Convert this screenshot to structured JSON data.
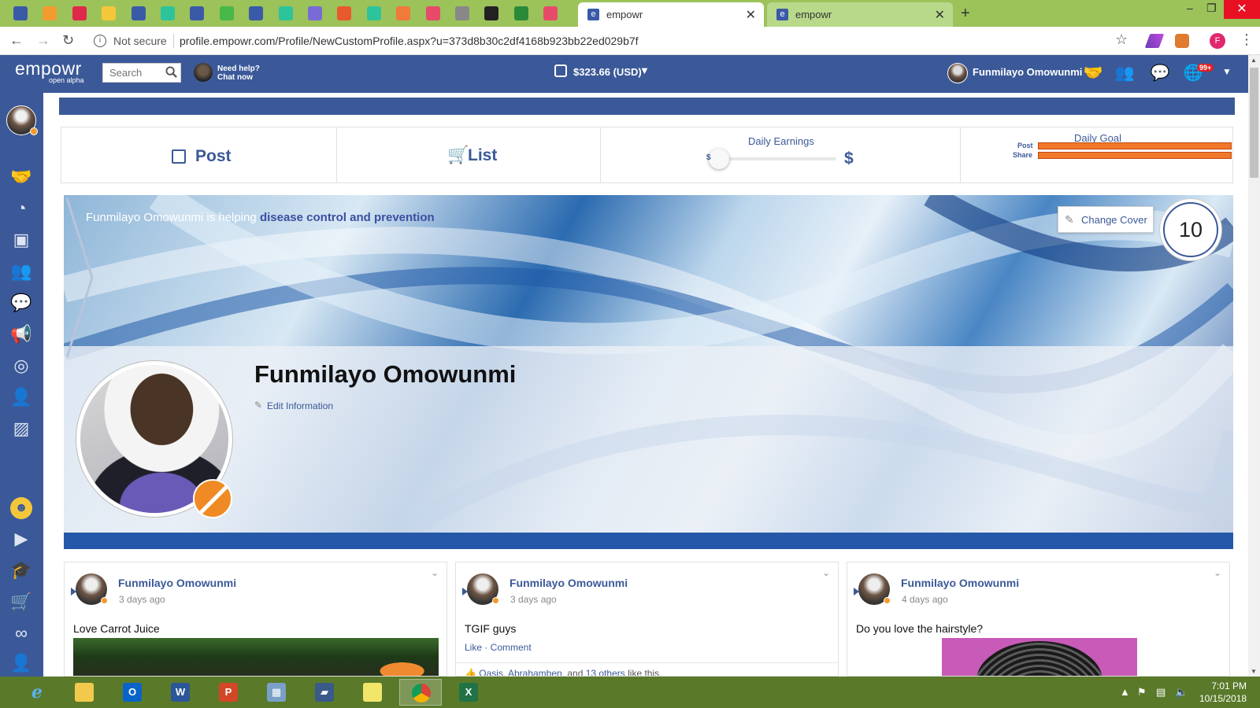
{
  "browser": {
    "tabs": [
      {
        "title": "empowr",
        "active": true
      },
      {
        "title": "empowr",
        "active": false
      }
    ],
    "security_label": "Not secure",
    "url": "profile.empowr.com/Profile/NewCustomProfile.aspx?u=373d8b30c2df4168b923bb22ed029b7f",
    "profile_initial": "F",
    "bookmark_colors": [
      "#3a5aa8",
      "#f29b2e",
      "#e0284a",
      "#f4c73a",
      "#3a5aa8",
      "#2ec49b",
      "#3a5aa8",
      "#48b848",
      "#3a5aa8",
      "#2ec49b",
      "#7a6ad8",
      "#e85a2e",
      "#2ec49b",
      "#f07a3a",
      "#e84a6a",
      "#888888",
      "#222222",
      "#2a8a3a",
      "#e84a6a"
    ]
  },
  "header": {
    "logo": "empowr",
    "logo_sub": "open alpha",
    "search_placeholder": "Search",
    "help_line1": "Need help?",
    "help_line2": "Chat now",
    "balance": "$323.66 (USD)",
    "balance_caret": "▼",
    "user_name": "Funmilayo Omowunmi",
    "notification_badge": "99+",
    "menu_caret": "▼"
  },
  "actions": {
    "post_label": "Post",
    "list_label": "List",
    "daily_earnings_label": "Daily Earnings",
    "earnings_min_symbol": "$",
    "earnings_max_symbol": "$",
    "earnings_slider_value": 0,
    "daily_goal_label": "Daily Goal",
    "goal_post_label": "Post",
    "goal_share_label": "Share",
    "goal_post_progress": 1.0,
    "goal_share_progress": 1.0
  },
  "profile": {
    "helping_prefix": "Funmilayo Omowunmi is helping",
    "cause": "disease control and prevention",
    "change_cover_label": "Change Cover",
    "score": "10",
    "name": "Funmilayo Omowunmi",
    "edit_info_label": "Edit Information"
  },
  "feed": [
    {
      "author": "Funmilayo Omowunmi",
      "time": "3 days ago",
      "text": "Love Carrot Juice"
    },
    {
      "author": "Funmilayo Omowunmi",
      "time": "3 days ago",
      "text": "TGIF guys",
      "links": "Like · Comment",
      "likes_names": "Oasis, Abrahamben",
      "likes_and": ", and ",
      "likes_others": "13 others",
      "likes_suffix": " like this."
    },
    {
      "author": "Funmilayo Omowunmi",
      "time": "4 days ago",
      "text": "Do you love the hairstyle?"
    }
  ],
  "taskbar": {
    "time": "7:01 PM",
    "date": "10/15/2018"
  },
  "colors": {
    "brand": "#3b5998",
    "tab_strip": "#9cc25a",
    "taskbar": "#5a7a2a",
    "goal_bar": "#f07828"
  }
}
